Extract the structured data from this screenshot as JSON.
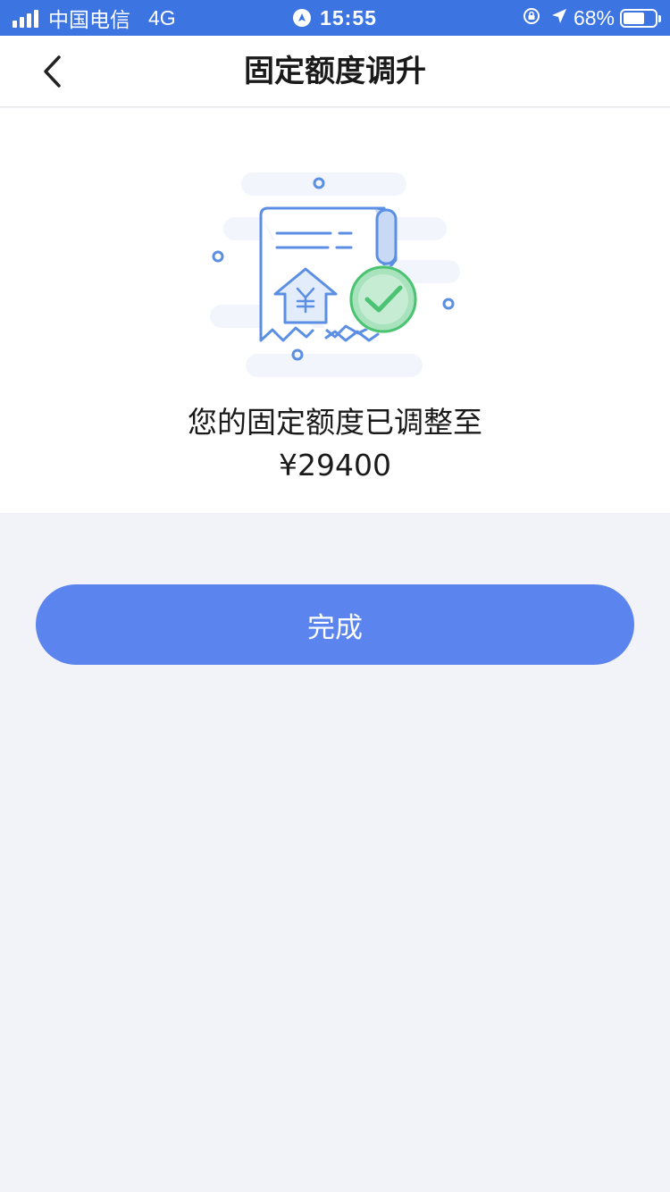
{
  "status_bar": {
    "carrier": "中国电信",
    "network": "4G",
    "time": "15:55",
    "battery_percent": "68%",
    "battery_level": 0.68
  },
  "nav": {
    "back_icon": "chevron-left-icon",
    "title": "固定额度调升"
  },
  "result": {
    "illustration_icon": "credit-limit-raised-receipt-icon",
    "message": "您的固定额度已调整至",
    "amount": "¥29400"
  },
  "actions": {
    "done_label": "完成"
  },
  "colors": {
    "status_bar": "#3c74e2",
    "button": "#5b84ee",
    "page_background": "#f1f3f8",
    "check_green": "#4cc372"
  }
}
